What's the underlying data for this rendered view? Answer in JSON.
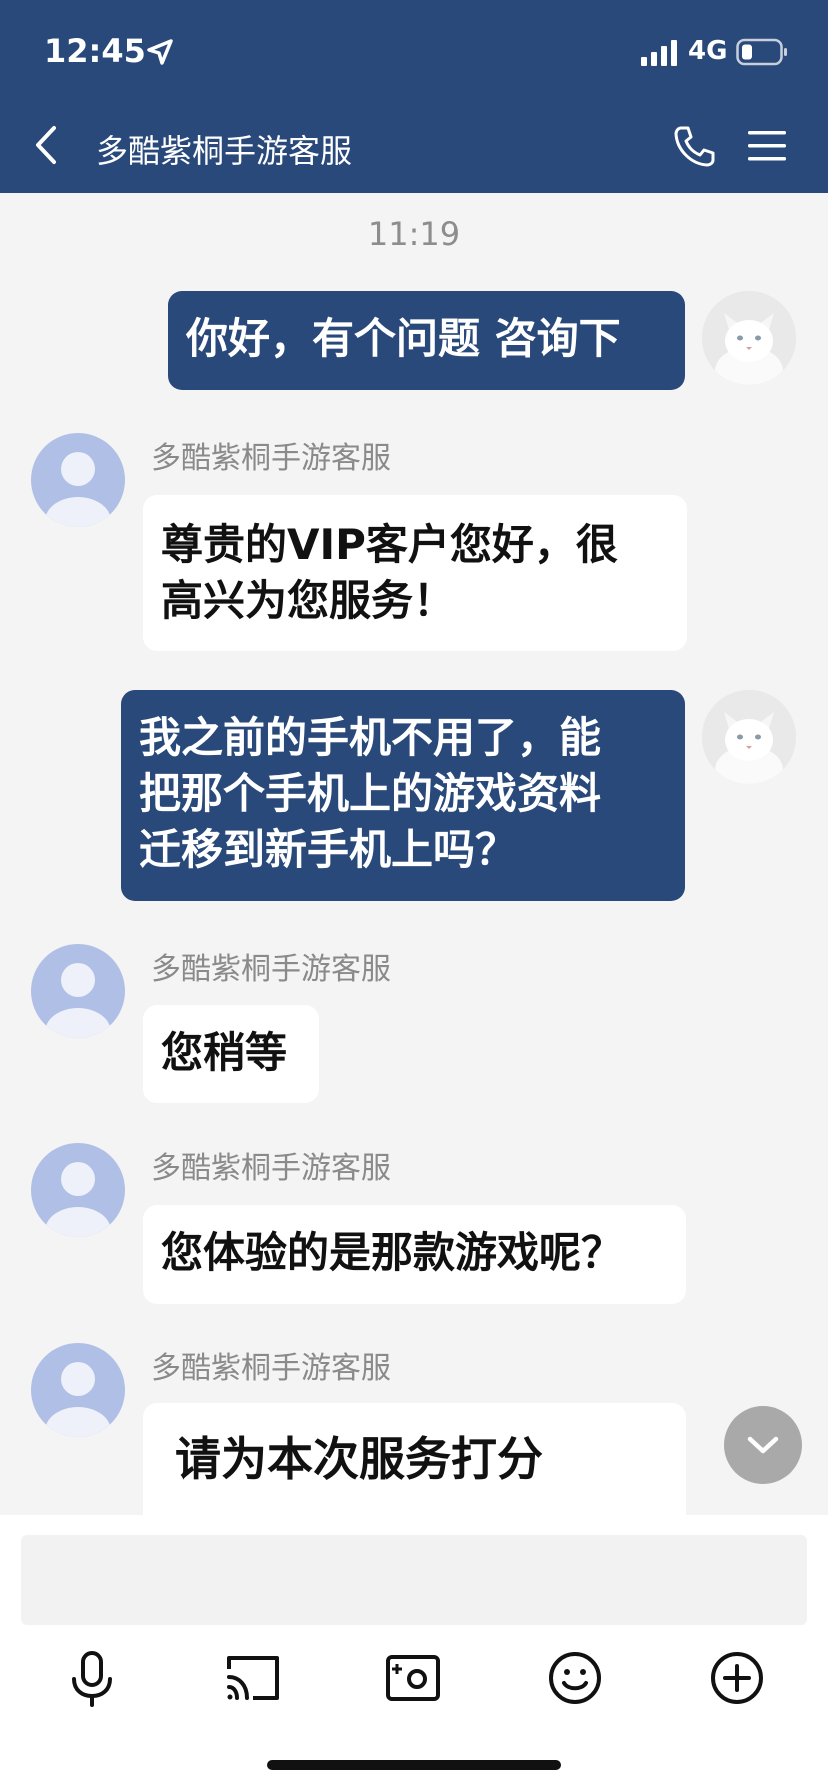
{
  "status_bar": {
    "time": "12:45",
    "network": "4G"
  },
  "header": {
    "title": "多酷紫桐手游客服"
  },
  "chat": {
    "timestamp": "11:19",
    "messages": [
      {
        "from": "user",
        "text": "你好，有个问题 咨询下"
      },
      {
        "from": "agent",
        "sender": "多酷紫桐手游客服",
        "lines": [
          "尊贵的VIP客户您好，很",
          "高兴为您服务！"
        ]
      },
      {
        "from": "user",
        "lines": [
          "我之前的手机不用了，能",
          "把那个手机上的游戏资料",
          "迁移到新手机上吗？"
        ]
      },
      {
        "from": "agent",
        "sender": "多酷紫桐手游客服",
        "text": "您稍等"
      },
      {
        "from": "agent",
        "sender": "多酷紫桐手游客服",
        "text": "您体验的是那款游戏呢？"
      },
      {
        "from": "agent",
        "sender": "多酷紫桐手游客服",
        "text": "请为本次服务打分"
      }
    ]
  },
  "input": {
    "value": "",
    "placeholder": ""
  },
  "toolbar": [
    "microphone-icon",
    "cast-screen-icon",
    "camera-icon",
    "emoji-icon",
    "add-icon"
  ],
  "colors": {
    "header_bg": "#29497a",
    "user_bubble": "#29497a",
    "agent_bubble": "#ffffff",
    "chat_bg": "#f4f4f4",
    "agent_avatar": "#b0bfe5"
  }
}
